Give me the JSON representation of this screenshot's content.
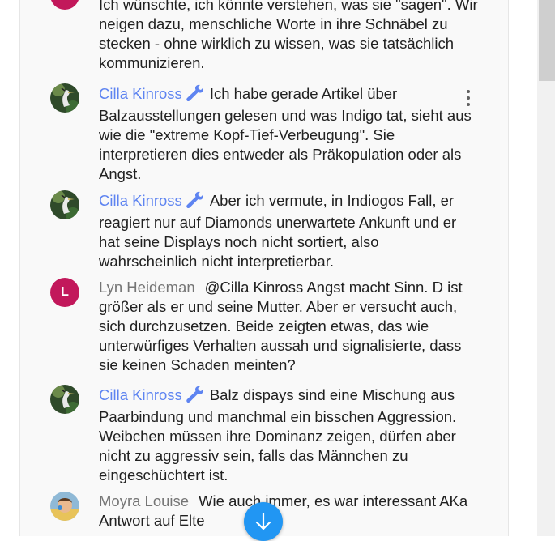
{
  "colors": {
    "moderator": "#5e84f1",
    "author_plain": "#757575",
    "avatar_L": "#c2185b",
    "accent_button": "#2196f3"
  },
  "messages": [
    {
      "author": "",
      "text": "Ich wünschte, ich könnte verstehen, was sie \"sagen\". Wir neigen dazu, menschliche Worte in ihre Schnäbel zu stecken - ohne wirklich zu wissen, was sie tatsächlich kommunizieren."
    },
    {
      "author": "Cilla Kinross",
      "moderator": true,
      "icon": "wrench-icon",
      "text": "Ich habe gerade Artikel über Balzausstellungen gelesen und was Indigo tat, sieht aus wie die \"extreme Kopf-Tief-Verbeugung\". Sie interpretieren dies entweder als Präkopulation oder als Angst."
    },
    {
      "author": "Cilla Kinross",
      "moderator": true,
      "icon": "wrench-icon",
      "text": "Aber ich vermute, in Indiogos Fall, er reagiert nur auf Diamonds unerwartete Ankunft und er hat seine Displays noch nicht sortiert, also wahrscheinlich nicht interpretierbar."
    },
    {
      "author": "Lyn Heideman",
      "avatar_letter": "L",
      "text": "@Cilla Kinross Angst macht Sinn. D ist größer als er und seine Mutter. Aber er versucht auch, sich durchzusetzen. Beide zeigten etwas, das wie unterwürfiges Verhalten aussah und signalisierte, dass sie keinen Schaden meinten?"
    },
    {
      "author": "Cilla Kinross",
      "moderator": true,
      "icon": "wrench-icon",
      "text": "Balz dispays sind eine Mischung aus Paarbindung und manchmal ein bisschen Aggression. Weibchen müssen ihre Dominanz zeigen, dürfen aber nicht zu aggressiv sein, falls das Männchen zu eingeschüchtert ist."
    },
    {
      "author": "Moyra Louise",
      "text": "Wie auch immer, es war interessant AKa Antwort auf Elte"
    }
  ]
}
